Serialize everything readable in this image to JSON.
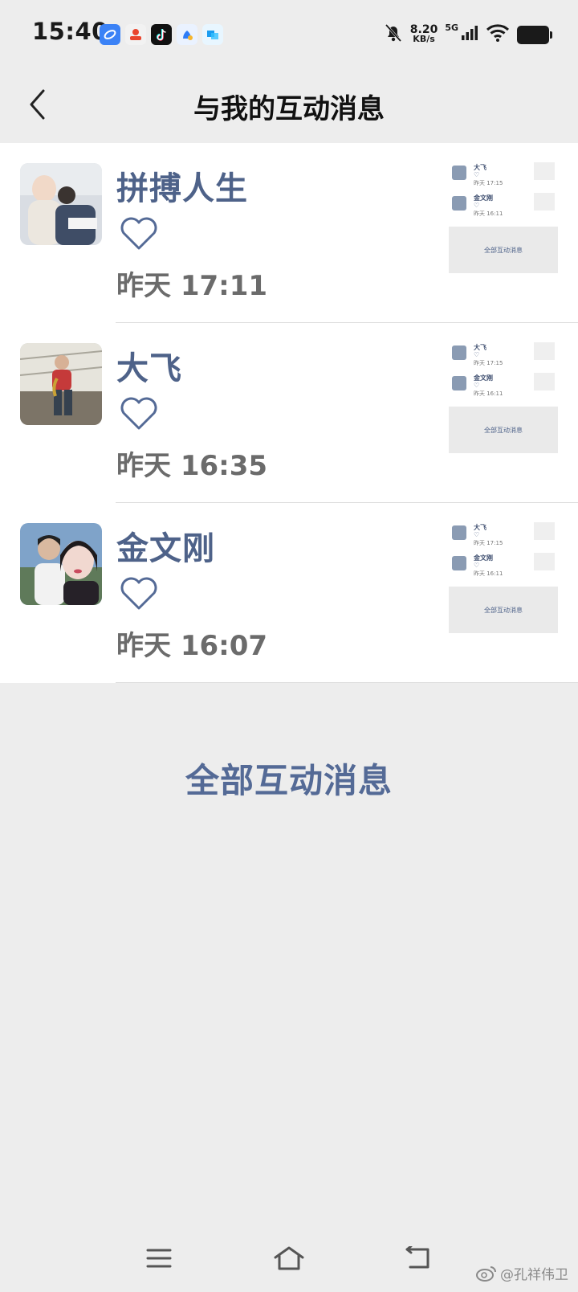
{
  "status_bar": {
    "time": "15:40",
    "net_speed_value": "8.20",
    "net_speed_unit": "KB/s",
    "net_type": "5G",
    "icons": [
      "browser-app-icon",
      "shopping-app-icon",
      "douyin-app-icon",
      "baidu-app-icon",
      "message-app-icon",
      "mute-bell-icon",
      "signal-icon",
      "wifi-icon",
      "battery-icon"
    ]
  },
  "header": {
    "title": "与我的互动消息",
    "back_icon": "chevron-left-icon"
  },
  "messages": [
    {
      "name": "拼搏人生",
      "time": "昨天 17:11",
      "icon": "heart-outline-icon",
      "thumbnail": {
        "rows": [
          {
            "name": "大飞",
            "time": "昨天 17:15"
          },
          {
            "name": "金文刚",
            "time": "昨天 16:11"
          }
        ],
        "footer": "全部互动消息"
      }
    },
    {
      "name": "大飞",
      "time": "昨天 16:35",
      "icon": "heart-outline-icon",
      "thumbnail": {
        "rows": [
          {
            "name": "大飞",
            "time": "昨天 17:15"
          },
          {
            "name": "金文刚",
            "time": "昨天 16:11"
          }
        ],
        "footer": "全部互动消息"
      }
    },
    {
      "name": "金文刚",
      "time": "昨天 16:07",
      "icon": "heart-outline-icon",
      "thumbnail": {
        "rows": [
          {
            "name": "大飞",
            "time": "昨天 17:15"
          },
          {
            "name": "金文刚",
            "time": "昨天 16:11"
          }
        ],
        "footer": "全部互动消息"
      }
    }
  ],
  "all_messages_label": "全部互动消息",
  "system_nav": {
    "icons": [
      "menu-icon",
      "home-icon",
      "back-return-icon"
    ]
  },
  "watermark": "@孔祥伟卫",
  "colors": {
    "accent": "#546a96",
    "name_color": "#4e6289",
    "time_color": "#6b6b6b",
    "background": "#ededed"
  }
}
